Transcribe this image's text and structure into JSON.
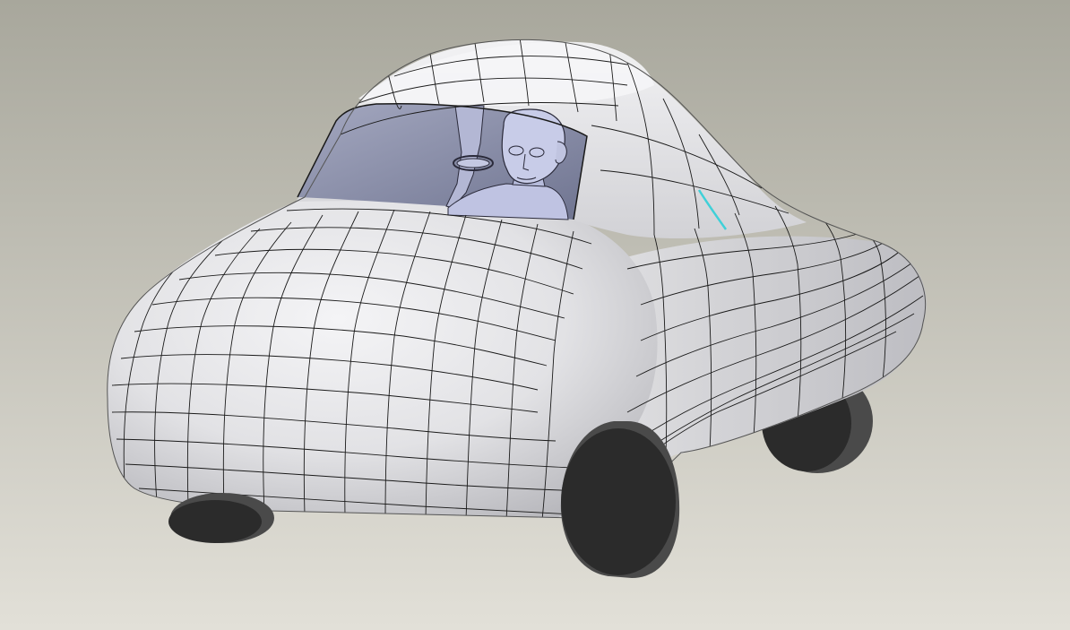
{
  "viewport": {
    "background_top": "#a8a79c",
    "background_bottom": "#e2e0d8"
  },
  "model": {
    "body_color": "#e6e6e8",
    "body_shadow": "#b9b9bd",
    "mesh_line_color": "#1a1a1a",
    "glass_color": "#8d92ad",
    "glass_dark": "#6e738f",
    "driver_color": "#b7bcdc",
    "tire_color": "#2b2b2b",
    "tire_side": "#4a4a4a",
    "highlight_edge_color": "#3fd0d8"
  }
}
